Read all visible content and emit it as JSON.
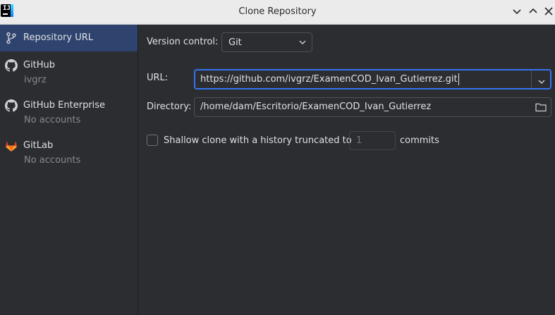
{
  "window": {
    "title": "Clone Repository",
    "app_icon": "intellij-idea-icon",
    "controls": [
      "minimize-icon",
      "maximize-icon",
      "close-icon"
    ]
  },
  "sidebar": {
    "items": [
      {
        "label": "Repository URL",
        "sub": "",
        "icon": "vcs-branch-icon",
        "selected": true
      },
      {
        "label": "GitHub",
        "sub": "ivgrz",
        "icon": "github-icon",
        "selected": false
      },
      {
        "label": "GitHub Enterprise",
        "sub": "No accounts",
        "icon": "github-icon",
        "selected": false
      },
      {
        "label": "GitLab",
        "sub": "No accounts",
        "icon": "gitlab-icon",
        "selected": false
      }
    ]
  },
  "form": {
    "version_control_label": "Version control:",
    "version_control_value": "Git",
    "url_label": "URL:",
    "url_value": "https://github.com/ivgrz/ExamenCOD_Ivan_Gutierrez.git",
    "directory_label": "Directory:",
    "directory_value": "/home/dam/Escritorio/ExamenCOD_Ivan_Gutierrez",
    "shallow_label": "Shallow clone with a history truncated to",
    "shallow_checked": false,
    "shallow_depth": "1",
    "commits_label": "commits"
  },
  "colors": {
    "background": "#2b2d30",
    "selection": "#2e436e",
    "focus_border": "#3574f0",
    "titlebar": "#ebebeb"
  }
}
